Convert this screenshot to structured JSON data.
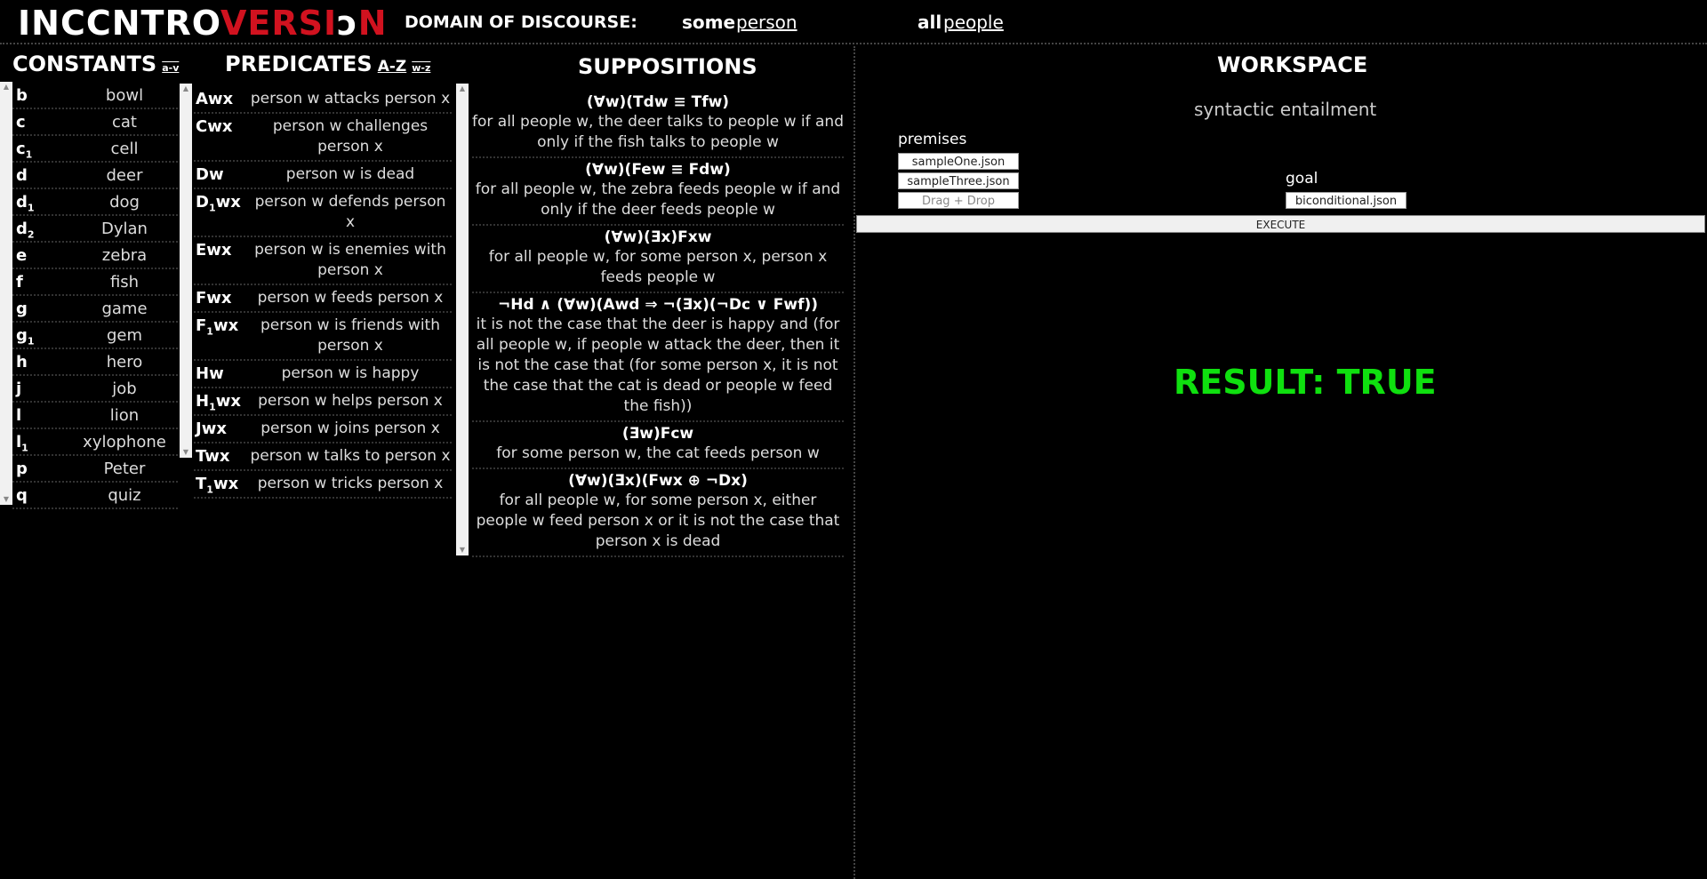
{
  "header": {
    "logo_parts": [
      {
        "text": "INC",
        "style": "w"
      },
      {
        "text": "C",
        "style": "w"
      },
      {
        "text": "NTRO",
        "style": "w"
      },
      {
        "text": "VERSI",
        "style": "r"
      },
      {
        "text": "ↄ",
        "style": "w"
      },
      {
        "text": "N",
        "style": "r"
      }
    ],
    "domain_label": "DOMAIN OF DISCOURSE:",
    "some_label": "some",
    "some_value": "person",
    "all_label": "all",
    "all_value": "people"
  },
  "constants": {
    "title": "CONSTANTS",
    "sort_label": "a-v",
    "items": [
      {
        "key": "b",
        "sub": "",
        "value": "bowl"
      },
      {
        "key": "c",
        "sub": "",
        "value": "cat"
      },
      {
        "key": "c",
        "sub": "1",
        "value": "cell"
      },
      {
        "key": "d",
        "sub": "",
        "value": "deer"
      },
      {
        "key": "d",
        "sub": "1",
        "value": "dog"
      },
      {
        "key": "d",
        "sub": "2",
        "value": "Dylan"
      },
      {
        "key": "e",
        "sub": "",
        "value": "zebra"
      },
      {
        "key": "f",
        "sub": "",
        "value": "fish"
      },
      {
        "key": "g",
        "sub": "",
        "value": "game"
      },
      {
        "key": "g",
        "sub": "1",
        "value": "gem"
      },
      {
        "key": "h",
        "sub": "",
        "value": "hero"
      },
      {
        "key": "j",
        "sub": "",
        "value": "job"
      },
      {
        "key": "l",
        "sub": "",
        "value": "lion"
      },
      {
        "key": "l",
        "sub": "1",
        "value": "xylophone"
      },
      {
        "key": "p",
        "sub": "",
        "value": "Peter"
      },
      {
        "key": "q",
        "sub": "",
        "value": "quiz"
      }
    ]
  },
  "predicates": {
    "title": "PREDICATES",
    "sort_az": "A-Z",
    "sort_wz": "w-z",
    "items": [
      {
        "key": "Awx",
        "sub": "",
        "keyrest": "",
        "value": "person w attacks person x"
      },
      {
        "key": "Cwx",
        "sub": "",
        "keyrest": "",
        "value": "person w challenges person x"
      },
      {
        "key": "Dw",
        "sub": "",
        "keyrest": "",
        "value": "person w is dead"
      },
      {
        "key": "D",
        "sub": "1",
        "keyrest": "wx",
        "value": "person w defends person x"
      },
      {
        "key": "Ewx",
        "sub": "",
        "keyrest": "",
        "value": "person w is enemies with person x"
      },
      {
        "key": "Fwx",
        "sub": "",
        "keyrest": "",
        "value": "person w feeds person x"
      },
      {
        "key": "F",
        "sub": "1",
        "keyrest": "wx",
        "value": "person w is friends with person x"
      },
      {
        "key": "Hw",
        "sub": "",
        "keyrest": "",
        "value": "person w is happy"
      },
      {
        "key": "H",
        "sub": "1",
        "keyrest": "wx",
        "value": "person w helps person x"
      },
      {
        "key": "Jwx",
        "sub": "",
        "keyrest": "",
        "value": "person w joins person x"
      },
      {
        "key": "Twx",
        "sub": "",
        "keyrest": "",
        "value": "person w talks to person x"
      },
      {
        "key": "T",
        "sub": "1",
        "keyrest": "wx",
        "value": "person w tricks person x"
      }
    ]
  },
  "suppositions": {
    "title": "SUPPOSITIONS",
    "items": [
      {
        "formula": "(∀w)(Tdw ≡ Tfw)",
        "text": "for all people w, the deer talks to people w if and only if the fish talks to people w"
      },
      {
        "formula": "(∀w)(Few ≡ Fdw)",
        "text": "for all people w, the zebra feeds people w if and only if the deer feeds people w"
      },
      {
        "formula": "(∀w)(Ǝx)Fxw",
        "text": "for all people w, for some person x, person x feeds people w"
      },
      {
        "formula": "¬Hd ∧ (∀w)(Awd ⇒ ¬(Ǝx)(¬Dc ∨ Fwf))",
        "text": "it is not the case that the deer is happy and (for all people w, if people w attack the deer, then it is not the case that (for some person x, it is not the case that the cat is dead or people w feed the fish))"
      },
      {
        "formula": "(Ǝw)Fcw",
        "text": "for some person w, the cat feeds person w"
      },
      {
        "formula": "(∀w)(Ǝx)(Fwx ⊕ ¬Dx)",
        "text": "for all people w, for some person x, either people w feed person x or it is not the case that person x is dead"
      }
    ]
  },
  "workspace": {
    "title": "WORKSPACE",
    "subtitle": "syntactic entailment",
    "premises_label": "premises",
    "premises": [
      "sampleOne.json",
      "sampleThree.json"
    ],
    "drop_label": "Drag + Drop",
    "goal_label": "goal",
    "goal": "biconditional.json",
    "execute_label": "EXECUTE",
    "result": "RESULT: TRUE"
  },
  "colors": {
    "background": "#000000",
    "logo_red": "#d1121f",
    "result_green": "#0fe00f"
  }
}
